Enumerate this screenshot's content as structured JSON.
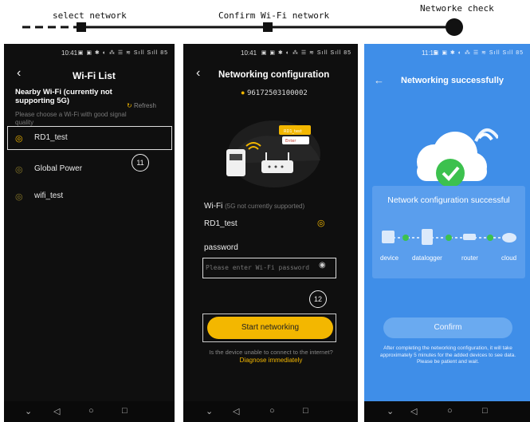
{
  "steps": {
    "select": "select network",
    "confirm": "Confirm Wi-Fi network",
    "check": "Networke check"
  },
  "phone1": {
    "time": "10:41",
    "status_icons": "▣ ▣ ✱ ◐ ⁂ ☰ ≋ Sıll Sıll 85",
    "title": "Wi-Fi List",
    "heading": "Nearby Wi-Fi (currently not supporting 5G)",
    "refresh": "Refresh",
    "subtext": "Please choose a Wi-Fi with good signal quality",
    "networks": [
      "RD1_test",
      "Global Power",
      "wifi_test"
    ],
    "callout": "11"
  },
  "phone2": {
    "time": "10:41",
    "status_icons": "▣ ▣ ✱ ◐ ⁂ ☰ ≋ Sıll Sıll 85",
    "title": "Networking configuration",
    "serial": "96172503100002",
    "popup_line1": "RD1_test",
    "popup_line2": "Enter",
    "wifi_label": "Wi-Fi",
    "wifi_note": "(5G not currently supported)",
    "ssid": "RD1_test",
    "password_label": "password",
    "password_placeholder": "Please enter Wi-Fi password",
    "callout": "12",
    "start_button": "Start networking",
    "help_text": "Is the device unable to connect to the internet?",
    "diagnose_link": "Diagnose immediately"
  },
  "phone3": {
    "time": "11:15",
    "status_icons": "▣ ▣ ✱ ◐ ⁂ ☰ ≋ Sıll Sıll 85",
    "title": "Networking successfully",
    "success_text": "Network configuration successful",
    "nodes": [
      "device",
      "datalogger",
      "router",
      "cloud"
    ],
    "confirm_button": "Confirm",
    "note": "After completing the networking configuration, it will take approximately 5 minutes for the added devices to see data. Please be patient and wait."
  },
  "colors": {
    "accent_yellow": "#f3b700",
    "success_green": "#3cc14e",
    "blue_bg": "#3f8ee8"
  }
}
